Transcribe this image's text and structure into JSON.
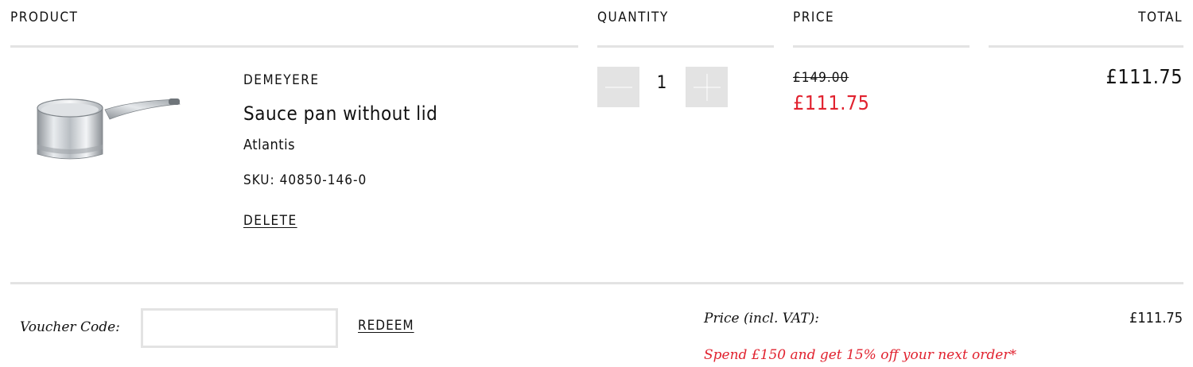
{
  "table_headers": {
    "product": "PRODUCT",
    "quantity": "QUANTITY",
    "price": "PRICE",
    "total": "TOTAL"
  },
  "cart_item": {
    "image_icon": "saucepan-image",
    "brand": "DEMEYERE",
    "name": "Sauce pan without lid",
    "variant": "Atlantis",
    "sku_label": "SKU:",
    "sku_value": "40850-146-0",
    "delete_label": "DELETE",
    "quantity": "1",
    "decrement_icon": "minus-icon",
    "increment_icon": "plus-icon",
    "original_price": "£149.00",
    "sale_price": "£111.75",
    "line_total": "£111.75"
  },
  "footer": {
    "voucher_label": "Voucher Code:",
    "voucher_value": "",
    "voucher_placeholder": "",
    "redeem_label": "REDEEM",
    "price_label": "Price (incl. VAT):",
    "price_value": "£111.75",
    "promo_text": "Spend £150 and get 15% off your next order*"
  },
  "colors": {
    "sale_red": "#e1222f",
    "divider_gray": "#e3e3e3",
    "text": "#111111"
  }
}
